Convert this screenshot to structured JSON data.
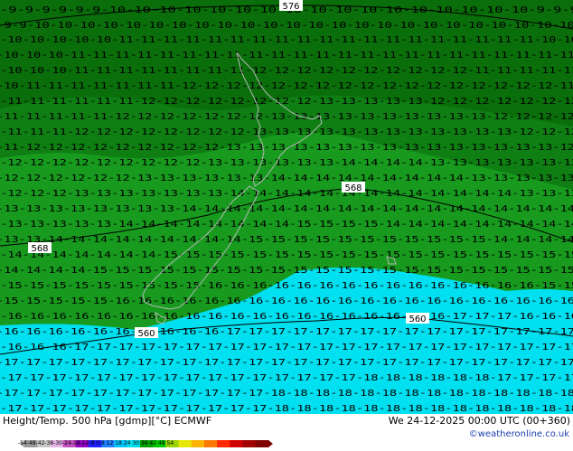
{
  "map": {
    "colors": {
      "green_dark": "#0a6e0a",
      "green_mid": "#0f7f14",
      "green_light": "#179a1e",
      "cyan": "#00e0f0",
      "coast": "#b8b8b8",
      "temp_text": "#000000"
    },
    "contour_labels": [
      "576",
      "568",
      "568",
      "560",
      "560"
    ],
    "temperature_rows": [
      "-9-9-9-9-9-9-10-10-10-10-10-10-10-10-10-10-10-10-10-10-10-10-10-9-9-9",
      "-9-9-10-10-10-10-10-10-10-10-10-10-10-10-10-10-10-10-10-10-10-10-10-10-10-10",
      "-10-10-10-10-10-11-11-11-11-11-11-11-11-11-11-11-11-11-11-11-11-11-11-11-10-10",
      "-10-10-10-11-11-11-11-11-11-11-11-11-11-11-11-11-11-11-11-11-11-11-11-11-11-11",
      "-10-10-10-11-11-11-11-11-11-11-11-12-12-12-12-12-12-12-12-12-12-11-11-11-11-11",
      "-10-11-11-11-11-11-11-11-12-12-12-12-12-12-12-12-12-12-12-12-12-12-12-12-12-11",
      "-11-11-11-11-11-11-12-12-12-12-12-12-12-12-13-13-13-13-13-12-12-12-12-12-12-12",
      "-11-11-11-11-11-12-12-12-12-12-12-12-13-13-13-13-13-13-13-13-13-13-12-12-12-12",
      "-11-11-11-12-12-12-12-12-12-12-12-13-13-13-13-13-13-13-13-13-13-13-13-12-12-12",
      "-11-12-12-12-12-12-12-12-12-12-13-13-13-13-13-13-13-13-13-13-13-13-13-13-13-12",
      "-12-12-12-12-12-12-12-12-12-13-13-13-13-13-13-14-14-14-14-13-13-13-13-13-13-13",
      "-12-12-12-12-12-12-13-13-13-13-13-13-14-14-14-14-14-14-14-14-14-13-13-13-13-13",
      "-12-12-12-13-13-13-13-13-13-13-14-14-14-14-14-14-14-14-14-14-14-14-14-13-13-13",
      "-13-13-13-13-13-13-13-13-14-14-14-14-14-14-14-14-14-14-14-14-14-14-14-14-14-14",
      "-13-13-13-13-13-14-14-14-14-14-14-14-14-15-15-15-15-14-14-14-14-14-14-14-14-14",
      "-13-13-14-14-14-14-14-14-14-14-14-15-15-15-15-15-15-15-15-15-15-15-14-14-14-14",
      "-14-14-14-14-14-14-14-15-15-15-15-15-15-15-15-15-15-15-15-15-15-15-15-15-15-15",
      "-14-14-14-14-15-15-15-15-15-15-15-15-15-15-15-15-15-15-15-15-15-15-15-15-15-15",
      "-15-15-15-15-15-15-15-15-15-16-16-16-16-16-16-16-16-16-16-16-16-16-16-16-15-15",
      "-15-15-15-15-15-16-16-16-16-16-16-16-16-16-16-16-16-16-16-16-16-16-16-16-16-16",
      "-16-16-16-16-16-16-16-16-16-16-16-16-16-16-16-16-16-16-16-16-17-17-17-16-16-16",
      "-16-16-16-16-16-16-16-16-16-16-17-17-17-17-17-17-17-17-17-17-17-17-17-17-17-17",
      "-16-16-16-17-17-17-17-17-17-17-17-17-17-17-17-17-17-17-17-17-17-17-17-17-17-17",
      "-17-17-17-17-17-17-17-17-17-17-17-17-17-17-17-17-17-17-17-17-17-17-17-17-17-17",
      "-17-17-17-17-17-17-17-17-17-17-17-17-17-17-17-17-18-18-18-18-18-18-17-17-17-17",
      "-17-17-17-17-17-17-17-17-17-17-17-17-18-18-18-18-18-18-18-18-18-18-18-18-18-18",
      "-17-17-17-17-17-17-17-17-17-17-17-17-18-18-18-18-18-18-18-18-18-18-18-18-18-18"
    ]
  },
  "footer": {
    "title_left": "Height/Temp. 500 hPa [gdmp][°C] ECMWF",
    "title_right": "We 24-12-2025 00:00 UTC (00+360)",
    "credit": "©weatheronline.co.uk",
    "colorbar_ticks": "-54-48-42-38-30-24-18-12-8 0 8 12 18 24 30 36 42 48 54",
    "colorbar_colors": [
      "#9a9a9a",
      "#c8c8c8",
      "#e6b4e6",
      "#c050c0",
      "#9000c0",
      "#2020ff",
      "#2080ff",
      "#00c8ff",
      "#00e0f0",
      "#00a000",
      "#00c800",
      "#9ad200",
      "#e6e600",
      "#ffb400",
      "#ff7800",
      "#ff2800",
      "#d00000",
      "#a00000",
      "#800000"
    ]
  }
}
